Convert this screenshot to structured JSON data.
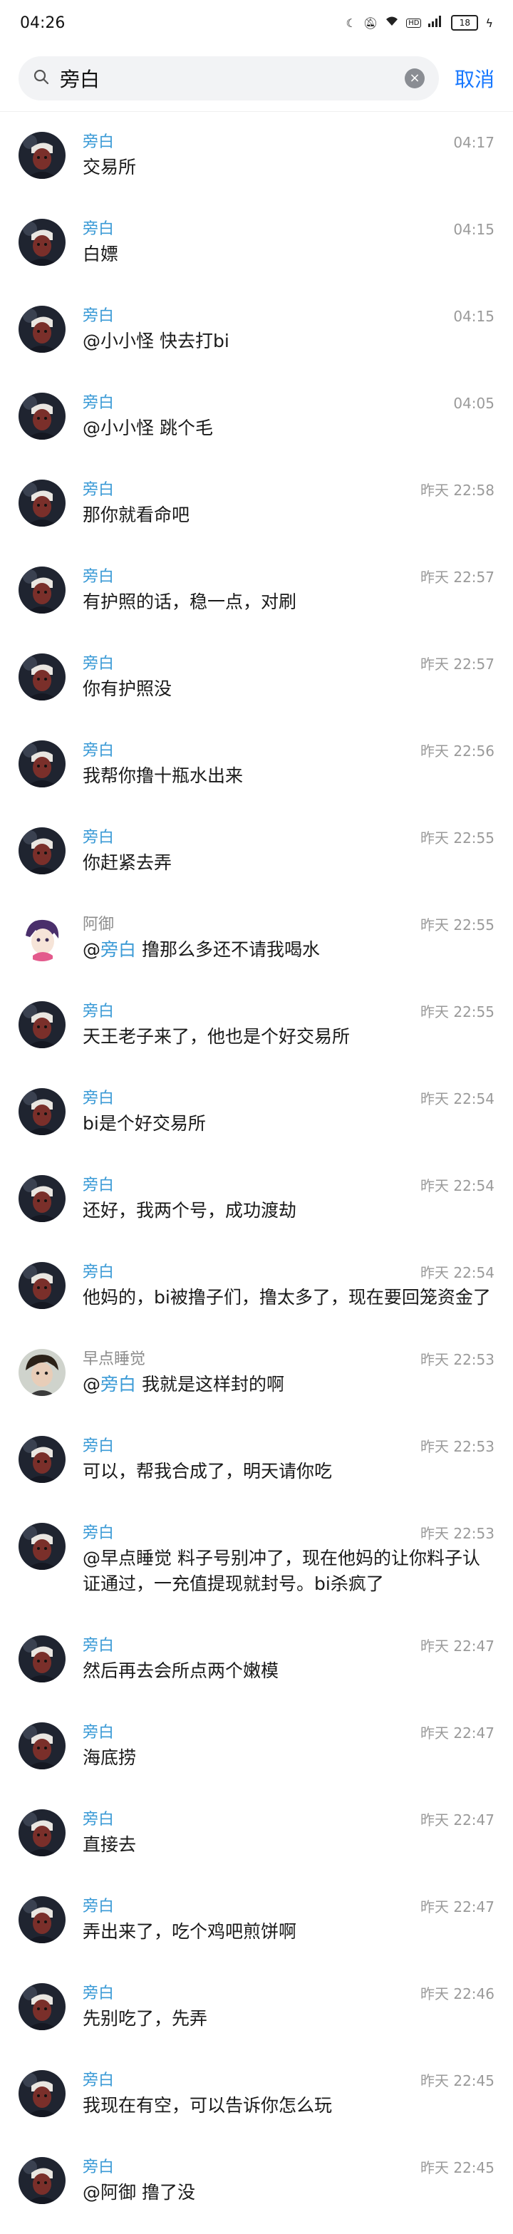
{
  "status_bar": {
    "time": "04:26",
    "battery": "18",
    "hd_label": "HD"
  },
  "search": {
    "value": "旁白",
    "clear": "×",
    "cancel": "取消"
  },
  "messages": [
    {
      "name": "旁白",
      "time": "04:17",
      "text": "交易所"
    },
    {
      "name": "旁白",
      "time": "04:15",
      "text": "白嫖"
    },
    {
      "name": "旁白",
      "time": "04:15",
      "text": "@小小怪 快去打bi"
    },
    {
      "name": "旁白",
      "time": "04:05",
      "text": "@小小怪 跳个毛"
    },
    {
      "name": "旁白",
      "time": "昨天 22:58",
      "text": "那你就看命吧"
    },
    {
      "name": "旁白",
      "time": "昨天 22:57",
      "text": "有护照的话，稳一点，对刷"
    },
    {
      "name": "旁白",
      "time": "昨天 22:57",
      "text": "你有护照没"
    },
    {
      "name": "旁白",
      "time": "昨天 22:56",
      "text": "我帮你撸十瓶水出来"
    },
    {
      "name": "旁白",
      "time": "昨天 22:55",
      "text": "你赶紧去弄"
    },
    {
      "name": "阿御",
      "time": "昨天 22:55",
      "prefix": "@",
      "mention": "旁白",
      "text": " 撸那么多还不请我喝水"
    },
    {
      "name": "旁白",
      "time": "昨天 22:55",
      "text": "天王老子来了，他也是个好交易所"
    },
    {
      "name": "旁白",
      "time": "昨天 22:54",
      "text": "bi是个好交易所"
    },
    {
      "name": "旁白",
      "time": "昨天 22:54",
      "text": "还好，我两个号，成功渡劫"
    },
    {
      "name": "旁白",
      "time": "昨天 22:54",
      "text": "他妈的，bi被撸子们，撸太多了，现在要回笼资金了"
    },
    {
      "name": "早点睡觉",
      "time": "昨天 22:53",
      "prefix": "@",
      "mention": "旁白",
      "text": " 我就是这样封的啊"
    },
    {
      "name": "旁白",
      "time": "昨天 22:53",
      "text": "可以，帮我合成了，明天请你吃"
    },
    {
      "name": "旁白",
      "time": "昨天 22:53",
      "text": "@早点睡觉 料子号别冲了，现在他妈的让你料子认证通过，一充值提现就封号。bi杀疯了"
    },
    {
      "name": "旁白",
      "time": "昨天 22:47",
      "text": "然后再去会所点两个嫩模"
    },
    {
      "name": "旁白",
      "time": "昨天 22:47",
      "text": "海底捞"
    },
    {
      "name": "旁白",
      "time": "昨天 22:47",
      "text": "直接去"
    },
    {
      "name": "旁白",
      "time": "昨天 22:47",
      "text": "弄出来了，吃个鸡吧煎饼啊"
    },
    {
      "name": "旁白",
      "time": "昨天 22:46",
      "text": "先别吃了，先弄"
    },
    {
      "name": "旁白",
      "time": "昨天 22:45",
      "text": "我现在有空，可以告诉你怎么玩"
    },
    {
      "name": "旁白",
      "time": "昨天 22:45",
      "text": "@阿御 撸了没"
    }
  ]
}
